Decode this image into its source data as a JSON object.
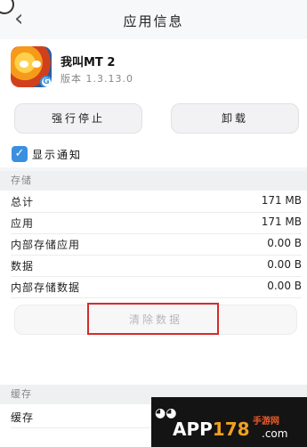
{
  "header": {
    "title": "应用信息",
    "back_icon": "chevron-left-icon"
  },
  "app": {
    "name": "我叫MT 2",
    "version": "版本 1.3.13.0",
    "icon": "app-icon"
  },
  "buttons": {
    "force_stop": "强行停止",
    "uninstall": "卸载"
  },
  "notify": {
    "label": "显示通知",
    "checked": true
  },
  "storage": {
    "section_title": "存储",
    "rows": [
      {
        "label": "总计",
        "value": "171 MB"
      },
      {
        "label": "应用",
        "value": "171 MB"
      },
      {
        "label": "内部存储应用",
        "value": "0.00 B"
      },
      {
        "label": "数据",
        "value": "0.00 B"
      },
      {
        "label": "内部存储数据",
        "value": "0.00 B"
      }
    ],
    "clear_data": "清除数据"
  },
  "cache": {
    "section_title": "缓存",
    "row_label": "缓存"
  },
  "watermark": {
    "app": "APP",
    "num": "178",
    "com": ".com",
    "sub": "手游网"
  },
  "colors": {
    "accent": "#3a8fe0",
    "highlight_box": "#d62b2b"
  }
}
